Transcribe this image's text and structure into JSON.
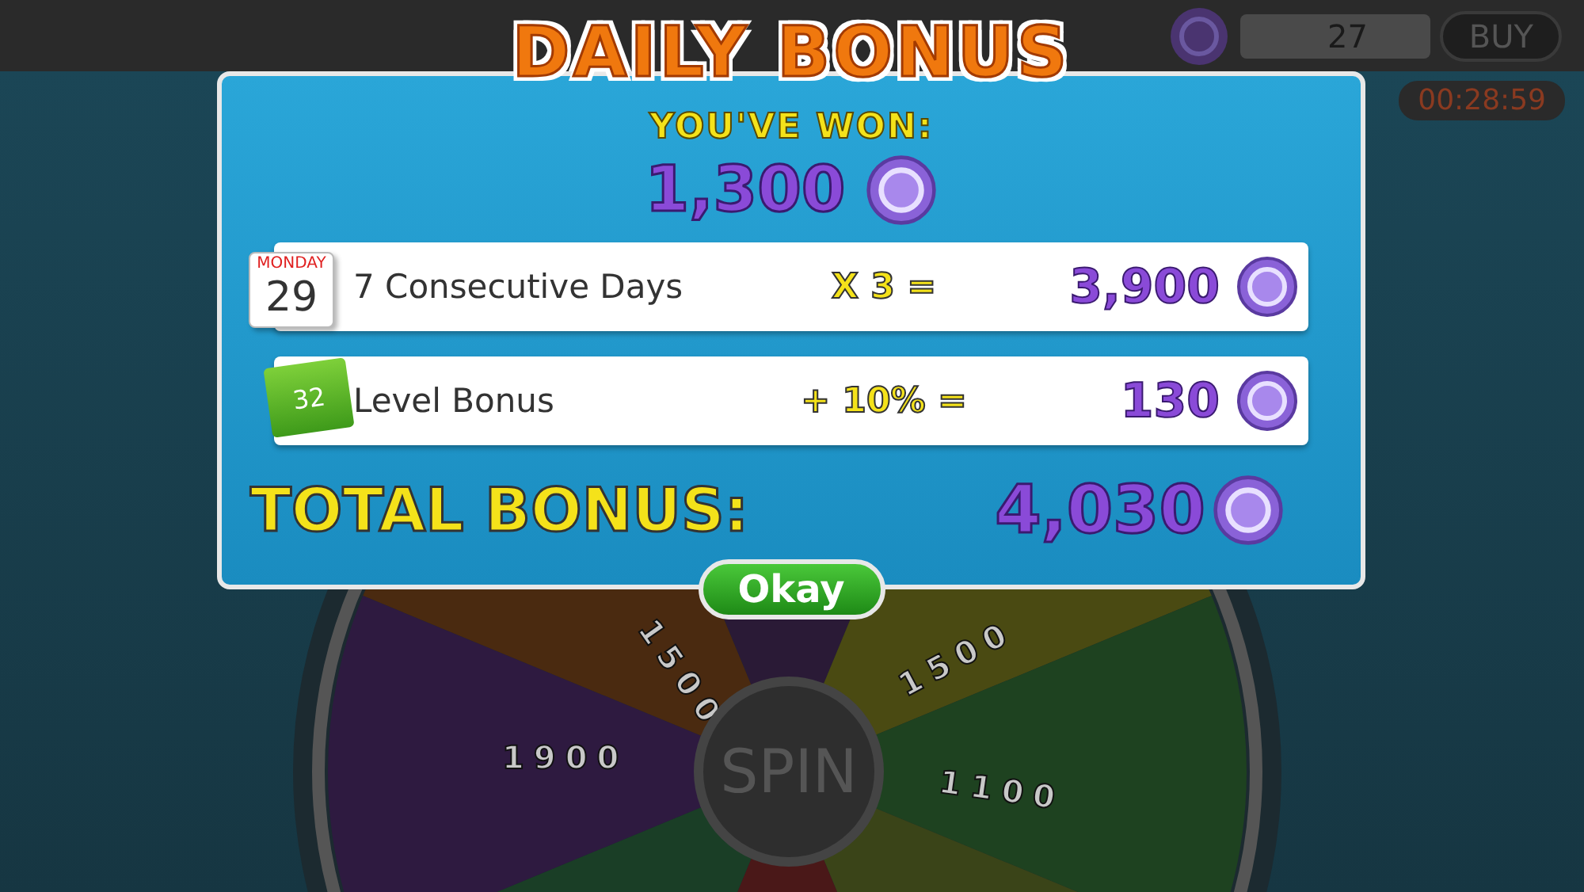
{
  "top_bar": {
    "chips": "27",
    "buy_button": "BUY",
    "timer": "00:28:59"
  },
  "wheel": {
    "labels": [
      "1500",
      "1900",
      "1500",
      "1100"
    ],
    "spin_button": "SPIN"
  },
  "dialog": {
    "title": "DAILY BONUS",
    "subtitle": "YOU'VE WON:",
    "amount": "1,300",
    "rows": [
      {
        "kind": "calendar",
        "badge_top": "MONDAY",
        "badge": "29",
        "label": "7 Consecutive Days",
        "operation": "X 3 =",
        "value": "3,900"
      },
      {
        "kind": "level",
        "badge": "32",
        "label": "Level Bonus",
        "operation": "+ 10% =",
        "value": "130"
      }
    ],
    "total_label": "TOTAL BONUS:",
    "total": "4,030",
    "button": "Okay"
  }
}
